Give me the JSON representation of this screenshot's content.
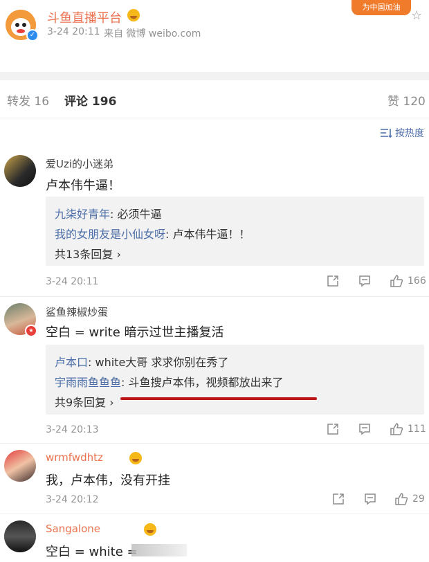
{
  "post": {
    "author": "斗鱼直播平台",
    "time": "3-24 20:11",
    "source": "来自 微博 weibo.com",
    "banner_text": "为中国加油"
  },
  "tabs": {
    "repost": "转发 16",
    "comment": "评论 196",
    "like": "赞 120"
  },
  "sort": {
    "label": "按热度"
  },
  "comments": [
    {
      "user": "爱Uzi的小迷弟",
      "text": "卢本伟牛逼！",
      "replies": [
        {
          "user": "九柒好青年",
          "text": ": 必须牛逼"
        },
        {
          "user": "我的女朋友是小仙女呀",
          "text": ": 卢本伟牛逼！！"
        }
      ],
      "more": "共13条回复 ›",
      "time": "3-24 20:11",
      "likes": "166"
    },
    {
      "user": "鲨鱼辣椒炒蛋",
      "text": "空白 = write 暗示过世主播复活",
      "replies": [
        {
          "user": "卢本口",
          "text": ": white大哥 求求你别在秀了"
        },
        {
          "user": "宇雨雨鱼鱼鱼",
          "text": ": 斗鱼搜卢本伟，视频都放出来了"
        }
      ],
      "more": "共9条回复 ›",
      "time": "3-24 20:13",
      "likes": "111"
    },
    {
      "user": "wrmfwdhtz",
      "text": "我，卢本伟，没有开挂",
      "time": "3-24 20:12",
      "likes": "29"
    },
    {
      "user": "Sangalone",
      "text": "空白 = white ="
    }
  ]
}
